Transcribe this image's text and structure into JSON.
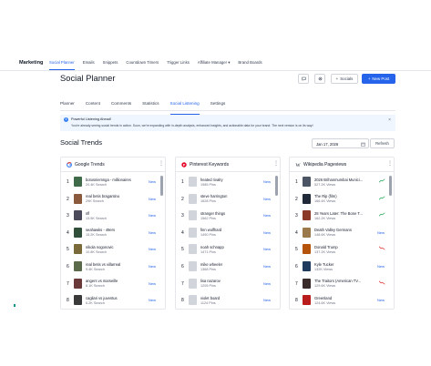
{
  "nav": {
    "brand": "Marketing",
    "links": [
      {
        "label": "Social Planner",
        "active": true
      },
      {
        "label": "Emails",
        "active": false
      },
      {
        "label": "Snippets",
        "active": false
      },
      {
        "label": "Countdown Timers",
        "active": false
      },
      {
        "label": "Trigger Links",
        "active": false
      },
      {
        "label": "Affiliate Manager",
        "active": false,
        "dropdown": true
      },
      {
        "label": "Brand Boards",
        "active": false
      }
    ]
  },
  "header": {
    "title": "Social Planner",
    "socials_label": "Socials",
    "new_post_label": "New Post",
    "icons": [
      "chat-icon",
      "gear-icon",
      "plus-icon"
    ]
  },
  "tabs": [
    {
      "label": "Planner",
      "active": false
    },
    {
      "label": "Content",
      "active": false
    },
    {
      "label": "Comments",
      "active": false
    },
    {
      "label": "Statistics",
      "active": false
    },
    {
      "label": "Social Listening",
      "active": true
    },
    {
      "label": "Settings",
      "active": false
    }
  ],
  "banner": {
    "title": "Powerful Listening Ahead!",
    "text": "You're already seeing social trends in action. Soon, we're expanding with in-depth analysis, enhanced insights, and actionable data for your brand. The next version is on its way!"
  },
  "trends": {
    "title": "Social Trends",
    "date": "Jan 17, 2026",
    "refresh_label": "Refresh"
  },
  "cards": [
    {
      "title": "Google Trends",
      "icon": "google-icon",
      "items": [
        {
          "rank": "1",
          "title": "botosniemnga - millionaires",
          "sub": "20.4K Search",
          "badge": "New",
          "color": "#3f6b4a"
        },
        {
          "rank": "2",
          "title": "real betis bragantino",
          "sub": "29K Search",
          "badge": "New",
          "color": "#8b5a3c"
        },
        {
          "rank": "3",
          "title": "nfl",
          "sub": "13.5K Search",
          "badge": "New",
          "color": "#4a4a5a"
        },
        {
          "rank": "4",
          "title": "seahawks - 49ers",
          "sub": "15.2K Search",
          "badge": "New",
          "color": "#2f4f3a"
        },
        {
          "rank": "5",
          "title": "nikola nogonovic",
          "sub": "10.8K Search",
          "badge": "New",
          "color": "#7a6a3a"
        },
        {
          "rank": "6",
          "title": "real betis vs villarreal",
          "sub": "9.4K Search",
          "badge": "New",
          "color": "#5a6a4a"
        },
        {
          "rank": "7",
          "title": "angers vs marseille",
          "sub": "8.1K Search",
          "badge": "New",
          "color": "#6a3a3a"
        },
        {
          "rank": "8",
          "title": "cagliari vs juventus",
          "sub": "6.2K Search",
          "badge": "New",
          "color": "#3a3a3a"
        }
      ]
    },
    {
      "title": "Pinterest Keywords",
      "icon": "pinterest-icon",
      "items": [
        {
          "rank": "1",
          "title": "heated rivalry",
          "sub": "1985 Pins",
          "badge": "New",
          "color": "#d1d5db"
        },
        {
          "rank": "2",
          "title": "steve harrington",
          "sub": "1628 Pins",
          "badge": "New",
          "color": "#d1d5db"
        },
        {
          "rank": "3",
          "title": "stranger things",
          "sub": "1562 Pins",
          "badge": "New",
          "color": "#d1d5db"
        },
        {
          "rank": "4",
          "title": "finn wolfhard",
          "sub": "1490 Pins",
          "badge": "New",
          "color": "#d1d5db"
        },
        {
          "rank": "5",
          "title": "noah schnapp",
          "sub": "1471 Pins",
          "badge": "New",
          "color": "#d1d5db"
        },
        {
          "rank": "6",
          "title": "mike wheeler",
          "sub": "1368 Pins",
          "badge": "New",
          "color": "#d1d5db"
        },
        {
          "rank": "7",
          "title": "lisa nazarov",
          "sub": "1205 Pins",
          "badge": "New",
          "color": "#d1d5db"
        },
        {
          "rank": "8",
          "title": "violet board",
          "sub": "1124 Pins",
          "badge": "New",
          "color": "#d1d5db"
        }
      ]
    },
    {
      "title": "Wikipedia Pageviews",
      "icon": "wikipedia-icon",
      "items": [
        {
          "rank": "1",
          "title": "2026 Brihanmumbai Munici...",
          "sub": "527.2K Views",
          "trend": "up",
          "color": "#4b5563"
        },
        {
          "rank": "2",
          "title": "The Rip (film)",
          "sub": "166.4K Views",
          "trend": "up",
          "color": "#1f2937"
        },
        {
          "rank": "3",
          "title": "28 Years Later: The Bone T...",
          "sub": "162.2K Views",
          "trend": "up",
          "color": "#8b3a2a"
        },
        {
          "rank": "4",
          "title": "Death Valley Germans",
          "sub": "148.6K Views",
          "badge": "New",
          "color": "#9a7a4a"
        },
        {
          "rank": "5",
          "title": "Donald Trump",
          "sub": "137.2K Views",
          "trend": "down",
          "color": "#b45309"
        },
        {
          "rank": "6",
          "title": "Kyle Tucker",
          "sub": "132K Views",
          "badge": "New",
          "color": "#1e3a5f"
        },
        {
          "rank": "7",
          "title": "The Traitors (American TV...",
          "sub": "129.6K Views",
          "trend": "down",
          "color": "#3a2a2a"
        },
        {
          "rank": "8",
          "title": "Greenland",
          "sub": "124.6K Views",
          "badge": "New",
          "color": "#b91c1c"
        }
      ]
    }
  ]
}
